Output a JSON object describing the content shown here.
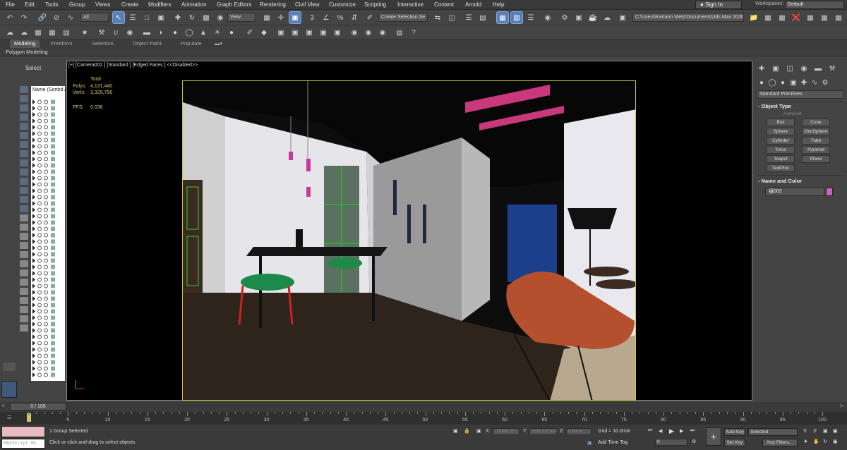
{
  "menu": [
    "File",
    "Edit",
    "Tools",
    "Group",
    "Views",
    "Create",
    "Modifiers",
    "Animation",
    "Graph Editors",
    "Rendering",
    "Civil View",
    "Customize",
    "Scripting",
    "Interactive",
    "Content",
    "Arnold",
    "Help"
  ],
  "signin_label": "Sign In",
  "workspaces_label": "Workspaces:",
  "workspaces_value": "Default",
  "toolbar": {
    "filter_value": "All",
    "refcoord_value": "View",
    "selection_set_value": "Create Selection Se",
    "path_value": "C:\\Users\\Keriann Metz\\Documents\\3ds Max 2020"
  },
  "ribbon_tabs": [
    "Modeling",
    "Freeform",
    "Selection",
    "Object Paint",
    "Populate"
  ],
  "ribbon_sub": "Polygon Modeling",
  "scene": {
    "title": "Select",
    "header": "Name (Sorted A"
  },
  "viewport": {
    "label": "[+] [Camera002 ] [Standard ] [Edged Faces ]  <<Disabled>>",
    "stats": {
      "total_label": "Total",
      "polys_label": "Polys:",
      "polys_value": "4,131,440",
      "verts_label": "Verts:",
      "verts_value": "3,329,756",
      "fps_label": "FPS:",
      "fps_value": "0.036"
    }
  },
  "command_panel": {
    "category": "Standard Primitives",
    "object_type_title": "Object Type",
    "autogrid": "AutoGrid",
    "object_buttons": [
      "Box",
      "Cone",
      "Sphere",
      "GeoSphere",
      "Cylinder",
      "Tube",
      "Torus",
      "Pyramid",
      "Teapot",
      "Plane",
      "TextPlus"
    ],
    "name_color_title": "Name and Color",
    "object_name": "组002",
    "object_color": "#d25fc3"
  },
  "timeline": {
    "slider": "0 / 100",
    "ticks": [
      "0",
      "5",
      "10",
      "15",
      "20",
      "25",
      "30",
      "35",
      "40",
      "45",
      "50",
      "55",
      "60",
      "65",
      "70",
      "75",
      "80",
      "85",
      "90",
      "95",
      "100"
    ]
  },
  "status": {
    "maxscript_placeholder": "MAXScript Mi",
    "selected": "1 Group Selected",
    "prompt": "Click or click-and-drag to select objects",
    "x_label": "X:",
    "x_value": "-15861.57",
    "y_label": "Y:",
    "y_value": "-531.017mm",
    "z_label": "Z:",
    "z_value": "0.0mm",
    "grid": "Grid = 10.0mm",
    "add_time_tag": "Add Time Tag",
    "frame_value": "0",
    "auto_key": "Auto Key",
    "set_key": "Set Key",
    "selected_dd": "Selected",
    "key_filters": "Key Filters..."
  }
}
